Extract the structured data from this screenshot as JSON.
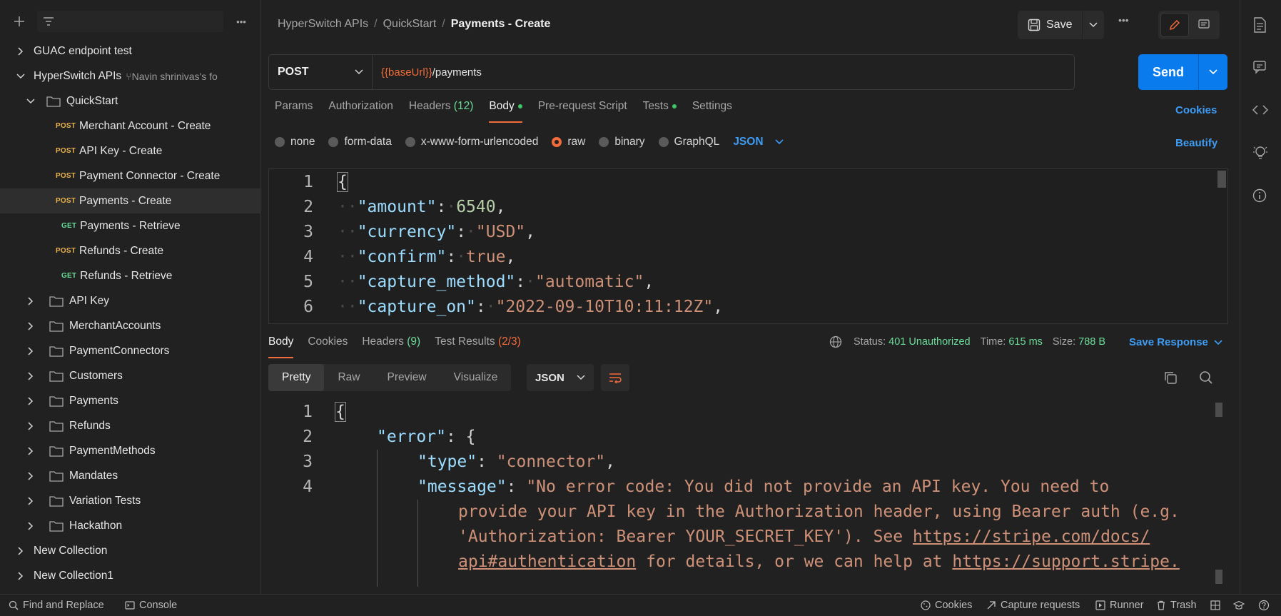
{
  "sidebar": {
    "filter_placeholder": "",
    "tree": [
      {
        "label": "GUAC endpoint test",
        "kind": "collection",
        "expanded": false
      },
      {
        "label": "HyperSwitch APIs",
        "kind": "collection",
        "expanded": true,
        "fork_note": "Navin shrinivas's fo"
      },
      {
        "label": "QuickStart",
        "kind": "folder",
        "expanded": true
      },
      {
        "method": "POST",
        "label": "Merchant Account - Create",
        "kind": "request"
      },
      {
        "method": "POST",
        "label": "API Key - Create",
        "kind": "request"
      },
      {
        "method": "POST",
        "label": "Payment Connector - Create",
        "kind": "request"
      },
      {
        "method": "POST",
        "label": "Payments - Create",
        "kind": "request",
        "selected": true
      },
      {
        "method": "GET",
        "label": "Payments - Retrieve",
        "kind": "request"
      },
      {
        "method": "POST",
        "label": "Refunds - Create",
        "kind": "request"
      },
      {
        "method": "GET",
        "label": "Refunds - Retrieve",
        "kind": "request"
      },
      {
        "label": "API Key",
        "kind": "folder"
      },
      {
        "label": "MerchantAccounts",
        "kind": "folder"
      },
      {
        "label": "PaymentConnectors",
        "kind": "folder"
      },
      {
        "label": "Customers",
        "kind": "folder"
      },
      {
        "label": "Payments",
        "kind": "folder"
      },
      {
        "label": "Refunds",
        "kind": "folder"
      },
      {
        "label": "PaymentMethods",
        "kind": "folder"
      },
      {
        "label": "Mandates",
        "kind": "folder"
      },
      {
        "label": "Variation Tests",
        "kind": "folder"
      },
      {
        "label": "Hackathon",
        "kind": "folder"
      },
      {
        "label": "New Collection",
        "kind": "collection"
      },
      {
        "label": "New Collection1",
        "kind": "collection"
      }
    ]
  },
  "breadcrumb": {
    "a": "HyperSwitch APIs",
    "b": "QuickStart",
    "current": "Payments - Create",
    "sep": "/"
  },
  "toolbar": {
    "save_label": "Save",
    "more": "•••"
  },
  "request": {
    "method": "POST",
    "url_var": "{{baseUrl}}",
    "url_path": "/payments",
    "send_label": "Send"
  },
  "req_tabs": {
    "params": "Params",
    "authorization": "Authorization",
    "headers": "Headers",
    "headers_count": "(12)",
    "body": "Body",
    "prerequest": "Pre-request Script",
    "tests": "Tests",
    "settings": "Settings",
    "cookies": "Cookies"
  },
  "body_types": {
    "none": "none",
    "form_data": "form-data",
    "urlencoded": "x-www-form-urlencoded",
    "raw": "raw",
    "binary": "binary",
    "graphql": "GraphQL",
    "format": "JSON",
    "beautify": "Beautify"
  },
  "request_body": {
    "l1": "{",
    "l2_key": "\"amount\"",
    "l2_val": "6540",
    "l3_key": "\"currency\"",
    "l3_val": "\"USD\"",
    "l4_key": "\"confirm\"",
    "l4_val": "true",
    "l5_key": "\"capture_method\"",
    "l5_val": "\"automatic\"",
    "l6_key": "\"capture_on\"",
    "l6_val": "\"2022-09-10T10:11:12Z\""
  },
  "resp_tabs": {
    "body": "Body",
    "cookies": "Cookies",
    "headers": "Headers",
    "headers_count": "(9)",
    "test_results": "Test Results",
    "test_count": "(2/3)"
  },
  "resp_meta": {
    "status_label": "Status:",
    "status": "401 Unauthorized",
    "time_label": "Time:",
    "time": "615 ms",
    "size_label": "Size:",
    "size": "788 B",
    "save_response": "Save Response"
  },
  "resp_view": {
    "pretty": "Pretty",
    "raw": "Raw",
    "preview": "Preview",
    "visualize": "Visualize",
    "format": "JSON"
  },
  "response_body": {
    "l1": "{",
    "l2_key": "\"error\"",
    "l3_key": "\"type\"",
    "l3_val": "\"connector\"",
    "l4_key": "\"message\"",
    "l4_val_a": "\"No error code: You did not provide an API key. You need to",
    "l4_val_b": "provide your API key in the Authorization header, using Bearer auth (e.g.",
    "l4_val_c": "'Authorization: Bearer YOUR_SECRET_KEY'). See ",
    "l4_url1": "https://stripe.com/docs/",
    "l4_url1b": "api#authentication",
    "l4_val_d": " for details, or we can help at ",
    "l4_url2": "https://support.stripe."
  },
  "statusbar": {
    "find_replace": "Find and Replace",
    "console": "Console",
    "cookies": "Cookies",
    "capture": "Capture requests",
    "runner": "Runner",
    "trash": "Trash"
  },
  "colors": {
    "accent": "#f26b3a",
    "primary_blue": "#097bed",
    "link_blue": "#3e9cf4",
    "success_green": "#6bdd9a",
    "post_method": "#eab24d",
    "get_method": "#6bdd9a"
  }
}
